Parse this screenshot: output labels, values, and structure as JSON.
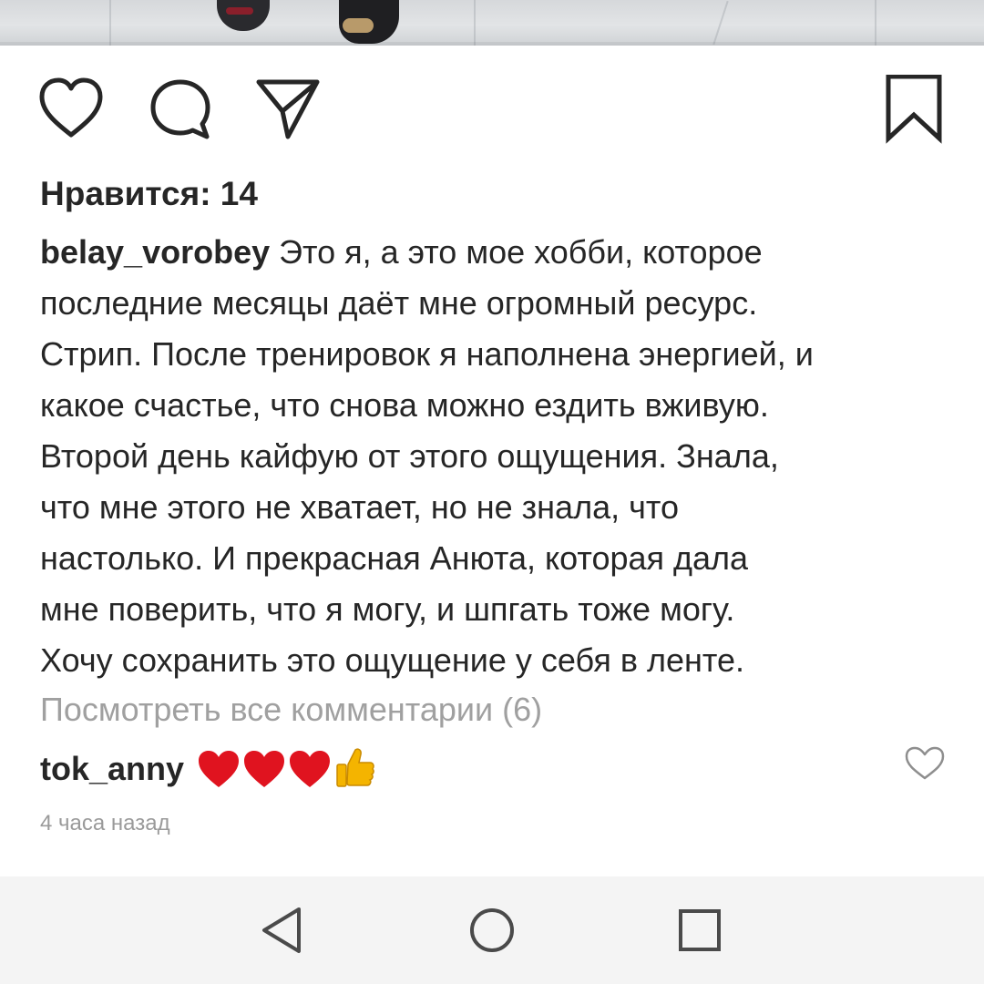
{
  "post": {
    "likes_label": "Нравится: 14",
    "author": "belay_vorobey",
    "caption_lines": [
      " Это я, а это мое хобби, которое",
      "последние месяцы даёт мне огромный ресурс.",
      "Стрип. После тренировок я наполнена энергией, и",
      "какое счастье, что снова можно ездить вживую.",
      "Второй день кайфую от этого ощущения. Знала,",
      "что мне этого не хватает, но не знала, что",
      "настолько. И прекрасная Анюта, которая дала",
      "мне поверить, что я могу, и шпгать тоже могу.",
      "Хочу сохранить это ощущение у себя в ленте."
    ],
    "view_all_comments": "Посмотреть все комментарии (6)",
    "comment": {
      "author": "tok_anny",
      "emojis": [
        "red-heart",
        "red-heart",
        "red-heart",
        "thumbs-up"
      ]
    },
    "timestamp": "4 часа назад"
  },
  "icons": {
    "like": "heart-outline-icon",
    "comment": "comment-bubble-icon",
    "share": "paper-plane-icon",
    "save": "bookmark-icon",
    "comment_like": "small-heart-icon",
    "nav_back": "triangle-back-icon",
    "nav_home": "circle-home-icon",
    "nav_recents": "square-recents-icon"
  },
  "colors": {
    "text": "#262626",
    "muted": "#a0a0a0",
    "heart": "#e0131f",
    "thumb": "#f4b400",
    "navbar": "#f4f4f4"
  }
}
